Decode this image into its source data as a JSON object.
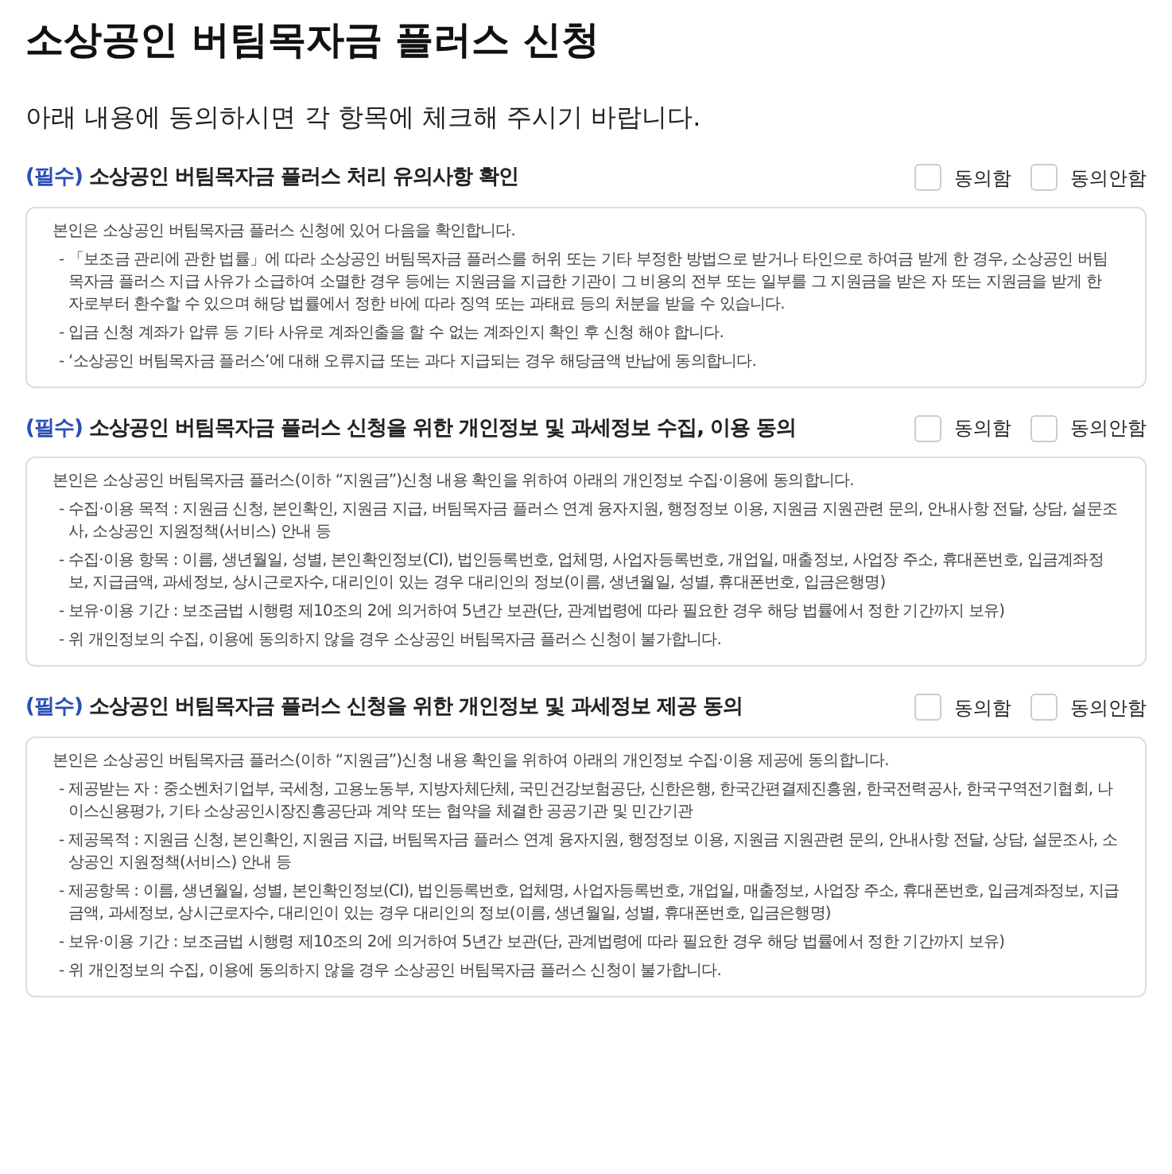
{
  "title": "소상공인 버팀목자금 플러스 신청",
  "subtitle": "아래 내용에 동의하시면 각 항목에 체크해 주시기 바랍니다.",
  "sections": [
    {
      "required": "(필수)",
      "heading": "소상공인 버팀목자금 플러스 처리 유의사항 확인",
      "options": [
        {
          "label": "동의함",
          "checked": false
        },
        {
          "label": "동의안함",
          "checked": false
        }
      ],
      "intro": "본인은 소상공인 버팀목자금 플러스 신청에 있어 다음을 확인합니다.",
      "items": [
        "- 「보조금 관리에 관한 법률」에 따라 소상공인 버팀목자금 플러스를 허위 또는 기타 부정한 방법으로 받거나 타인으로 하여금 받게 한 경우, 소상공인 버팀목자금 플러스 지급 사유가 소급하여 소멸한 경우 등에는 지원금을 지급한 기관이 그 비용의 전부 또는 일부를 그 지원금을 받은 자 또는 지원금을 받게 한 자로부터 환수할 수 있으며 해당 법률에서 정한 바에 따라 징역 또는 과태료 등의 처분을 받을 수 있습니다.",
        "- 입금 신청 계좌가 압류 등 기타 사유로 계좌인출을 할 수 없는 계좌인지 확인 후 신청 해야 합니다.",
        "- ‘소상공인 버팀목자금 플러스’에 대해 오류지급 또는 과다 지급되는 경우 해당금액 반납에 동의합니다."
      ]
    },
    {
      "required": "(필수)",
      "heading": "소상공인 버팀목자금 플러스 신청을 위한 개인정보 및 과세정보 수집, 이용 동의",
      "options": [
        {
          "label": "동의함",
          "checked": false
        },
        {
          "label": "동의안함",
          "checked": false
        }
      ],
      "intro": "본인은 소상공인 버팀목자금 플러스(이하 “지원금”)신청 내용 확인을 위하여 아래의 개인정보 수집·이용에 동의합니다.",
      "items": [
        "- 수집·이용 목적 : 지원금 신청, 본인확인, 지원금 지급, 버팀목자금 플러스 연계 융자지원, 행정정보 이용, 지원금 지원관련 문의, 안내사항 전달, 상담, 설문조사, 소상공인 지원정책(서비스) 안내 등",
        "- 수집·이용 항목 : 이름, 생년월일, 성별, 본인확인정보(CI), 법인등록번호, 업체명, 사업자등록번호, 개업일, 매출정보, 사업장 주소, 휴대폰번호, 입금계좌정보, 지급금액, 과세정보, 상시근로자수, 대리인이 있는 경우 대리인의 정보(이름, 생년월일, 성별, 휴대폰번호, 입금은행명)",
        "- 보유·이용 기간 : 보조금법 시행령 제10조의 2에 의거하여 5년간 보관(단, 관계법령에 따라 필요한 경우 해당 법률에서 정한 기간까지 보유)",
        "- 위 개인정보의 수집, 이용에 동의하지 않을 경우 소상공인 버팀목자금 플러스 신청이 불가합니다."
      ]
    },
    {
      "required": "(필수)",
      "heading": "소상공인 버팀목자금 플러스 신청을 위한 개인정보 및 과세정보 제공 동의",
      "options": [
        {
          "label": "동의함",
          "checked": false
        },
        {
          "label": "동의안함",
          "checked": false
        }
      ],
      "intro": "본인은 소상공인 버팀목자금 플러스(이하 “지원금”)신청 내용 확인을 위하여 아래의 개인정보 수집·이용 제공에 동의합니다.",
      "items": [
        "- 제공받는 자 : 중소벤처기업부, 국세청, 고용노동부, 지방자체단체, 국민건강보험공단, 신한은행, 한국간편결제진흥원, 한국전력공사, 한국구역전기협회, 나이스신용평가, 기타 소상공인시장진흥공단과 계약 또는 협약을 체결한 공공기관 및 민간기관",
        "- 제공목적 : 지원금 신청, 본인확인, 지원금 지급, 버팀목자금 플러스 연계 융자지원, 행정정보 이용, 지원금 지원관련 문의, 안내사항 전달, 상담, 설문조사, 소상공인 지원정책(서비스) 안내 등",
        "- 제공항목 : 이름, 생년월일, 성별, 본인확인정보(CI), 법인등록번호, 업체명, 사업자등록번호, 개업일, 매출정보, 사업장 주소, 휴대폰번호, 입금계좌정보, 지급금액, 과세정보, 상시근로자수, 대리인이 있는 경우 대리인의 정보(이름, 생년월일, 성별, 휴대폰번호, 입금은행명)",
        "- 보유·이용 기간 : 보조금법 시행령 제10조의 2에 의거하여 5년간 보관(단, 관계법령에 따라 필요한 경우 해당 법률에서 정한 기간까지 보유)",
        "- 위 개인정보의 수집, 이용에 동의하지 않을 경우 소상공인 버팀목자금 플러스 신청이 불가합니다."
      ]
    }
  ]
}
